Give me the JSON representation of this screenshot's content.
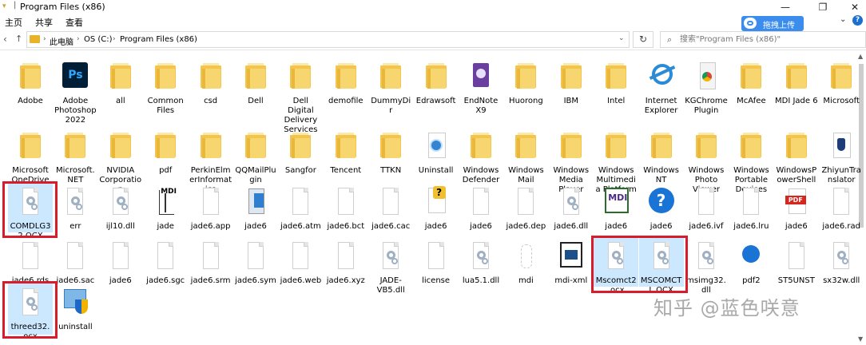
{
  "window": {
    "title": "Program Files (x86)",
    "qa_separator": "|"
  },
  "ribbon": {
    "tabs": [
      "主页",
      "共享",
      "查看"
    ]
  },
  "baidu": {
    "label": "拖拽上传"
  },
  "address": {
    "crumbs": [
      "此电脑",
      "OS (C:)",
      "Program Files (x86)"
    ]
  },
  "search": {
    "placeholder": "搜索\"Program Files (x86)\""
  },
  "watermark": "知乎 @蓝色咲意",
  "items": [
    {
      "label": "Adobe",
      "icon": "folder"
    },
    {
      "label": "Adobe Photoshop 2022",
      "icon": "ps"
    },
    {
      "label": "all",
      "icon": "folder"
    },
    {
      "label": "Common Files",
      "icon": "folder"
    },
    {
      "label": "csd",
      "icon": "folder"
    },
    {
      "label": "Dell",
      "icon": "folder"
    },
    {
      "label": "Dell Digital Delivery Services",
      "icon": "folder"
    },
    {
      "label": "demofile",
      "icon": "folder"
    },
    {
      "label": "DummyDir",
      "icon": "folder"
    },
    {
      "label": "Edrawsoft",
      "icon": "folder"
    },
    {
      "label": "EndNote X9",
      "icon": "endnote"
    },
    {
      "label": "Huorong",
      "icon": "folder"
    },
    {
      "label": "IBM",
      "icon": "folder"
    },
    {
      "label": "Intel",
      "icon": "folder"
    },
    {
      "label": "Internet Explorer",
      "icon": "ie"
    },
    {
      "label": "KGChromePlugin",
      "icon": "chrome"
    },
    {
      "label": "McAfee",
      "icon": "folder"
    },
    {
      "label": "MDI Jade 6",
      "icon": "folder"
    },
    {
      "label": "Microsoft",
      "icon": "folder"
    },
    {
      "label": "Microsoft OneDrive",
      "icon": "folder"
    },
    {
      "label": "Microsoft.NET",
      "icon": "folder"
    },
    {
      "label": "NVIDIA Corporation",
      "icon": "folder"
    },
    {
      "label": "pdf",
      "icon": "folder"
    },
    {
      "label": "PerkinElmerInformatics",
      "icon": "folder"
    },
    {
      "label": "QQMailPlugin",
      "icon": "folder"
    },
    {
      "label": "Sangfor",
      "icon": "folder"
    },
    {
      "label": "Tencent",
      "icon": "folder"
    },
    {
      "label": "TTKN",
      "icon": "folder"
    },
    {
      "label": "Uninstall",
      "icon": "uninst"
    },
    {
      "label": "Windows Defender",
      "icon": "folder"
    },
    {
      "label": "Windows Mail",
      "icon": "folder"
    },
    {
      "label": "Windows Media Player",
      "icon": "folder"
    },
    {
      "label": "Windows Multimedia Platform",
      "icon": "folder"
    },
    {
      "label": "Windows NT",
      "icon": "folder"
    },
    {
      "label": "Windows Photo Viewer",
      "icon": "folder"
    },
    {
      "label": "Windows Portable Devices",
      "icon": "folder"
    },
    {
      "label": "WindowsPowerShell",
      "icon": "folder"
    },
    {
      "label": "ZhiyunTranslator",
      "icon": "zyt"
    },
    {
      "label": "COMDLG32.OCX",
      "icon": "gear",
      "selected": true
    },
    {
      "label": "err",
      "icon": "gear"
    },
    {
      "label": "ijl10.dll",
      "icon": "gear"
    },
    {
      "label": "jade",
      "icon": "jade"
    },
    {
      "label": "jade6.app",
      "icon": "doc"
    },
    {
      "label": "jade6",
      "icon": "jade6a"
    },
    {
      "label": "jade6.atm",
      "icon": "doc"
    },
    {
      "label": "jade6.bct",
      "icon": "doc"
    },
    {
      "label": "jade6.cac",
      "icon": "doc"
    },
    {
      "label": "jade6",
      "icon": "help6"
    },
    {
      "label": "jade6",
      "icon": "doc"
    },
    {
      "label": "jade6.dep",
      "icon": "doc"
    },
    {
      "label": "jade6.dll",
      "icon": "gear"
    },
    {
      "label": "jade6",
      "icon": "mdi6"
    },
    {
      "label": "jade6",
      "icon": "qmark"
    },
    {
      "label": "jade6.ivf",
      "icon": "doc"
    },
    {
      "label": "jade6.lru",
      "icon": "doc"
    },
    {
      "label": "jade6",
      "icon": "pdf"
    },
    {
      "label": "jade6.rad",
      "icon": "doc"
    },
    {
      "label": "jade6.rds",
      "icon": "doc"
    },
    {
      "label": "jade6.sac",
      "icon": "doc"
    },
    {
      "label": "jade6",
      "icon": "doc"
    },
    {
      "label": "jade6.sgc",
      "icon": "doc"
    },
    {
      "label": "jade6.srm",
      "icon": "doc"
    },
    {
      "label": "jade6.sym",
      "icon": "doc"
    },
    {
      "label": "jade6.web",
      "icon": "doc"
    },
    {
      "label": "jade6.xyz",
      "icon": "doc"
    },
    {
      "label": "JADE-VB5.dll",
      "icon": "gear"
    },
    {
      "label": "license",
      "icon": "doc"
    },
    {
      "label": "lua5.1.dll",
      "icon": "gear"
    },
    {
      "label": "mdi",
      "icon": "mdiapp"
    },
    {
      "label": "mdi-xml",
      "icon": "mdix"
    },
    {
      "label": "Mscomct2.ocx",
      "icon": "gear",
      "selected": true
    },
    {
      "label": "MSCOMCTL.OCX",
      "icon": "gear",
      "selected": true
    },
    {
      "label": "msimg32.dll",
      "icon": "gear"
    },
    {
      "label": "pdf2",
      "icon": "pdf2"
    },
    {
      "label": "ST5UNST",
      "icon": "doc"
    },
    {
      "label": "sx32w.dll",
      "icon": "gear"
    },
    {
      "label": "threed32.ocx",
      "icon": "gear",
      "selected": true
    },
    {
      "label": "uninstall",
      "icon": "uninst2"
    }
  ]
}
